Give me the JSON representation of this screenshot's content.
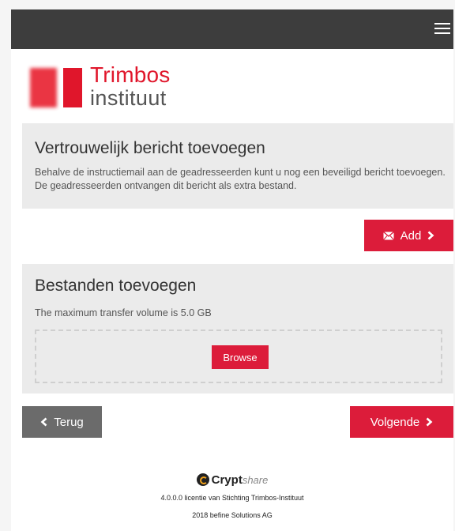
{
  "header": {
    "menu_icon": "hamburger-menu-icon"
  },
  "logo": {
    "line1": "Trimbos",
    "line2": "instituut",
    "colors": {
      "brand_red": "#e0162b",
      "text_gray": "#555555"
    }
  },
  "message_panel": {
    "title": "Vertrouwelijk bericht toevoegen",
    "description": "Behalve de instructiemail aan de geadresseerden kunt u nog een beveiligd bericht toevoegen. De geadresseerden ontvangen dit bericht als extra bestand.",
    "add_button": {
      "label": "Add",
      "icon": "envelope-icon",
      "trailing_icon": "chevron-right-icon"
    }
  },
  "files_panel": {
    "title": "Bestanden toevoegen",
    "note": "The maximum transfer volume is 5.0 GB",
    "browse_label": "Browse"
  },
  "navigation": {
    "back_label": "Terug",
    "back_icon": "chevron-left-icon",
    "next_label": "Volgende",
    "next_icon": "chevron-right-icon"
  },
  "footer": {
    "brand_bold": "Crypt",
    "brand_light": "share",
    "license_line": "4.0.0.0 licentie van Stichting Trimbos-Instituut",
    "copyright_line": "2018 befine Solutions AG"
  },
  "colors": {
    "accent_red": "#dc1c3a",
    "topbar": "#3d3d3d",
    "panel_bg": "#ebebeb",
    "secondary_button": "#6b6b6b"
  }
}
